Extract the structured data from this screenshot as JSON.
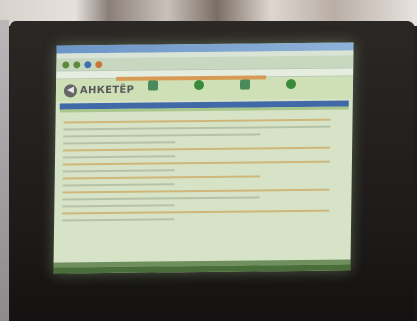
{
  "site": {
    "logo_text": "АНКЕТЁР"
  }
}
